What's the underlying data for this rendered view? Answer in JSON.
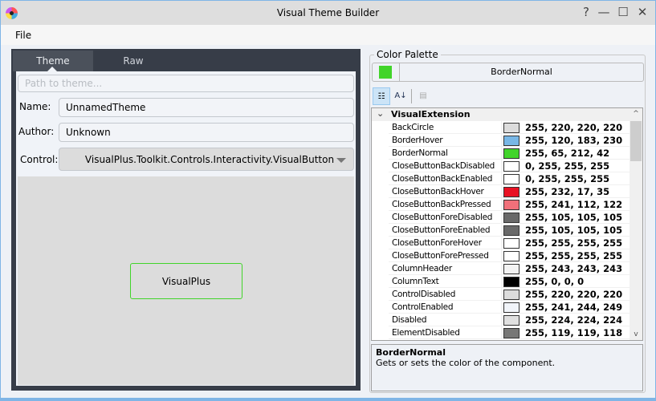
{
  "window": {
    "title": "Visual Theme Builder",
    "help": "?",
    "minimize": "—",
    "maximize": "☐",
    "close": "✕"
  },
  "menu": {
    "file": "File"
  },
  "left": {
    "tabs": [
      {
        "label": "Theme"
      },
      {
        "label": "Raw"
      }
    ],
    "path_placeholder": "Path to theme...",
    "name_label": "Name:",
    "name_value": "UnnamedTheme",
    "author_label": "Author:",
    "author_value": "Unknown",
    "control_label": "Control:",
    "control_value": "VisualPlus.Toolkit.Controls.Interactivity.VisualButton",
    "preview_button": "VisualPlus"
  },
  "palette": {
    "legend": "Color Palette",
    "selected_name": "BorderNormal",
    "selected_color": "#41d42a",
    "toolbar": {
      "categorized": "categorized-icon",
      "alphabetical": "sort-az-icon",
      "pages": "property-pages-icon"
    },
    "category": "VisualExtension",
    "items": [
      {
        "name": "BackCircle",
        "value": "255, 220, 220, 220",
        "color": "#dcdcdc"
      },
      {
        "name": "BorderHover",
        "value": "255, 120, 183, 230",
        "color": "#78b7e6"
      },
      {
        "name": "BorderNormal",
        "value": "255, 65, 212, 42",
        "color": "#41d42a"
      },
      {
        "name": "CloseButtonBackDisabled",
        "value": "0, 255, 255, 255",
        "color": "#ffffff"
      },
      {
        "name": "CloseButtonBackEnabled",
        "value": "0, 255, 255, 255",
        "color": "#ffffff"
      },
      {
        "name": "CloseButtonBackHover",
        "value": "255, 232, 17, 35",
        "color": "#e81123"
      },
      {
        "name": "CloseButtonBackPressed",
        "value": "255, 241, 112, 122",
        "color": "#f1707a"
      },
      {
        "name": "CloseButtonForeDisabled",
        "value": "255, 105, 105, 105",
        "color": "#696969"
      },
      {
        "name": "CloseButtonForeEnabled",
        "value": "255, 105, 105, 105",
        "color": "#696969"
      },
      {
        "name": "CloseButtonForeHover",
        "value": "255, 255, 255, 255",
        "color": "#ffffff"
      },
      {
        "name": "CloseButtonForePressed",
        "value": "255, 255, 255, 255",
        "color": "#ffffff"
      },
      {
        "name": "ColumnHeader",
        "value": "255, 243, 243, 243",
        "color": "#f3f3f3"
      },
      {
        "name": "ColumnText",
        "value": "255, 0, 0, 0",
        "color": "#000000"
      },
      {
        "name": "ControlDisabled",
        "value": "255, 220, 220, 220",
        "color": "#dcdcdc"
      },
      {
        "name": "ControlEnabled",
        "value": "255, 241, 244, 249",
        "color": "#f1f4f9"
      },
      {
        "name": "Disabled",
        "value": "255, 224, 224, 224",
        "color": "#e0e0e0"
      },
      {
        "name": "ElementDisabled",
        "value": "255, 119, 119, 118",
        "color": "#777776"
      }
    ],
    "help_title": "BorderNormal",
    "help_text": "Gets or sets the color of the component."
  }
}
